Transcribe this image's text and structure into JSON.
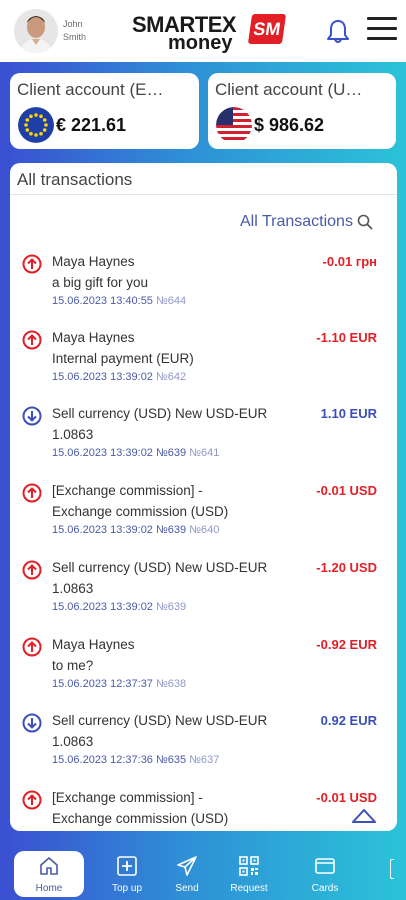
{
  "user": {
    "first_name": "John",
    "last_name": "Smith"
  },
  "logo": {
    "line1": "SMARTEX",
    "line2": "money",
    "badge": "SM"
  },
  "accounts": [
    {
      "title": "Client account (E…",
      "amount": "€ 221.61",
      "flag": "eu-flag-icon"
    },
    {
      "title": "Client account (U…",
      "amount": "$ 986.62",
      "flag": "us-flag-icon"
    }
  ],
  "transactions_card": {
    "title": "All transactions",
    "all_link": "All Transactions"
  },
  "transactions": [
    {
      "line1": "Maya Haynes",
      "line2": "a big gift for you",
      "date": "15.06.2023 13:40:55",
      "num": "№644",
      "amount": "-0.01 грн",
      "direction": "out"
    },
    {
      "line1": "Maya Haynes",
      "line2": "Internal payment (EUR)",
      "date": "15.06.2023 13:39:02",
      "num": "№642",
      "amount": "-1.10 EUR",
      "direction": "out"
    },
    {
      "line1": "Sell currency (USD) New USD-EUR",
      "line2": "1.0863",
      "date": "15.06.2023 13:39:02 №639",
      "num": "№641",
      "amount": "1.10 EUR",
      "direction": "in"
    },
    {
      "line1": "[Exchange commission] -",
      "line2": "Exchange commission (USD)",
      "date": "15.06.2023 13:39:02 №639",
      "num": "№640",
      "amount": "-0.01 USD",
      "direction": "out"
    },
    {
      "line1": "Sell currency (USD) New USD-EUR",
      "line2": "1.0863",
      "date": "15.06.2023 13:39:02",
      "num": "№639",
      "amount": "-1.20 USD",
      "direction": "out"
    },
    {
      "line1": "Maya Haynes",
      "line2": "to me?",
      "date": "15.06.2023 12:37:37",
      "num": "№638",
      "amount": "-0.92 EUR",
      "direction": "out"
    },
    {
      "line1": "Sell currency (USD) New USD-EUR",
      "line2": "1.0863",
      "date": "15.06.2023 12:37:36 №635",
      "num": "№637",
      "amount": "0.92 EUR",
      "direction": "in"
    },
    {
      "line1": "[Exchange commission] -",
      "line2": "Exchange commission (USD)",
      "date": "",
      "num": "",
      "amount": "-0.01 USD",
      "direction": "out"
    }
  ],
  "nav": [
    {
      "label": "Home",
      "icon": "home-icon",
      "active": true
    },
    {
      "label": "Top up",
      "icon": "plus-square-icon",
      "active": false
    },
    {
      "label": "Send",
      "icon": "send-icon",
      "active": false
    },
    {
      "label": "Request",
      "icon": "qr-code-icon",
      "active": false
    },
    {
      "label": "Cards",
      "icon": "card-icon",
      "active": false
    }
  ],
  "colors": {
    "negative": "#e21f26",
    "positive": "#3b4fb8",
    "brand_red": "#e21f26"
  }
}
